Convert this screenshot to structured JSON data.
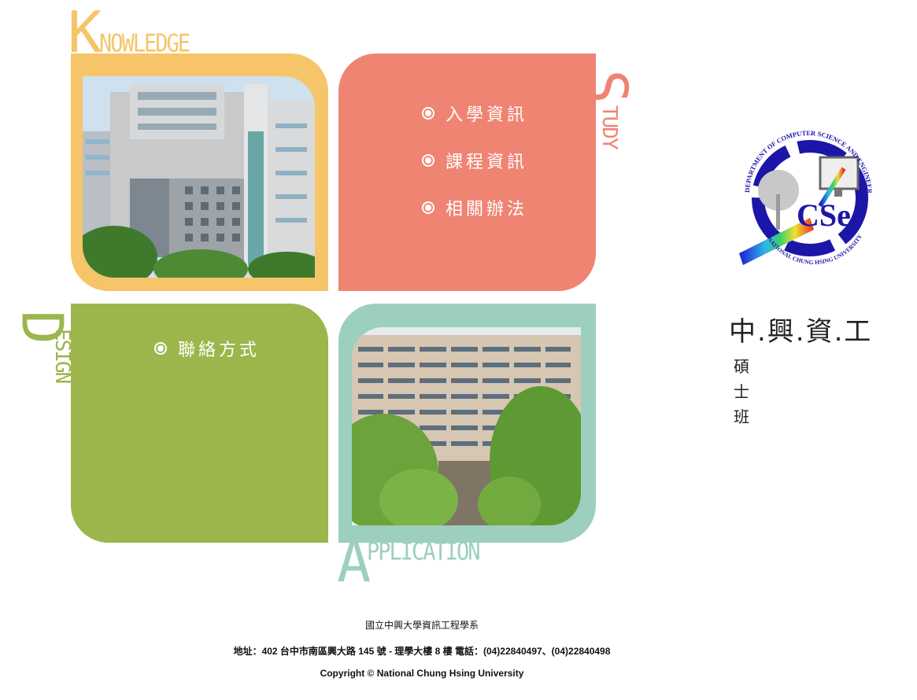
{
  "quadrants": {
    "knowledge": {
      "first_letter": "K",
      "rest": "NOWLEDGE"
    },
    "study": {
      "first_letter": "S",
      "rest": "TUDY"
    },
    "design": {
      "first_letter": "D",
      "rest": "ESIGN"
    },
    "application": {
      "first_letter": "A",
      "rest": "PPLICATION"
    }
  },
  "menu": {
    "admission": "入學資訊",
    "courses": "課程資訊",
    "regulations": "相關辦法",
    "contact": "聯絡方式"
  },
  "sidebar": {
    "logo_top_text": "DEPARTMENT OF COMPUTER SCIENCE AND ENGINEERING",
    "logo_bottom_text": "NATIONAL CHUNG HSING UNIVERSITY",
    "logo_mark": "CSe",
    "dept_title": "中.興.資.工",
    "program_name": "碩士班"
  },
  "footer": {
    "school_dept": "國立中興大學資訊工程學系",
    "address_line": "地址：402 台中市南區興大路 145 號 - 理學大樓 8 樓 電話：(04)22840497、(04)22840498",
    "copyright": "Copyright © National Chung Hsing University"
  },
  "colors": {
    "knowledge": "#f6c56a",
    "study": "#ef8472",
    "design": "#9cb64b",
    "application": "#9ccfbe",
    "logo_blue": "#1c16a8"
  }
}
